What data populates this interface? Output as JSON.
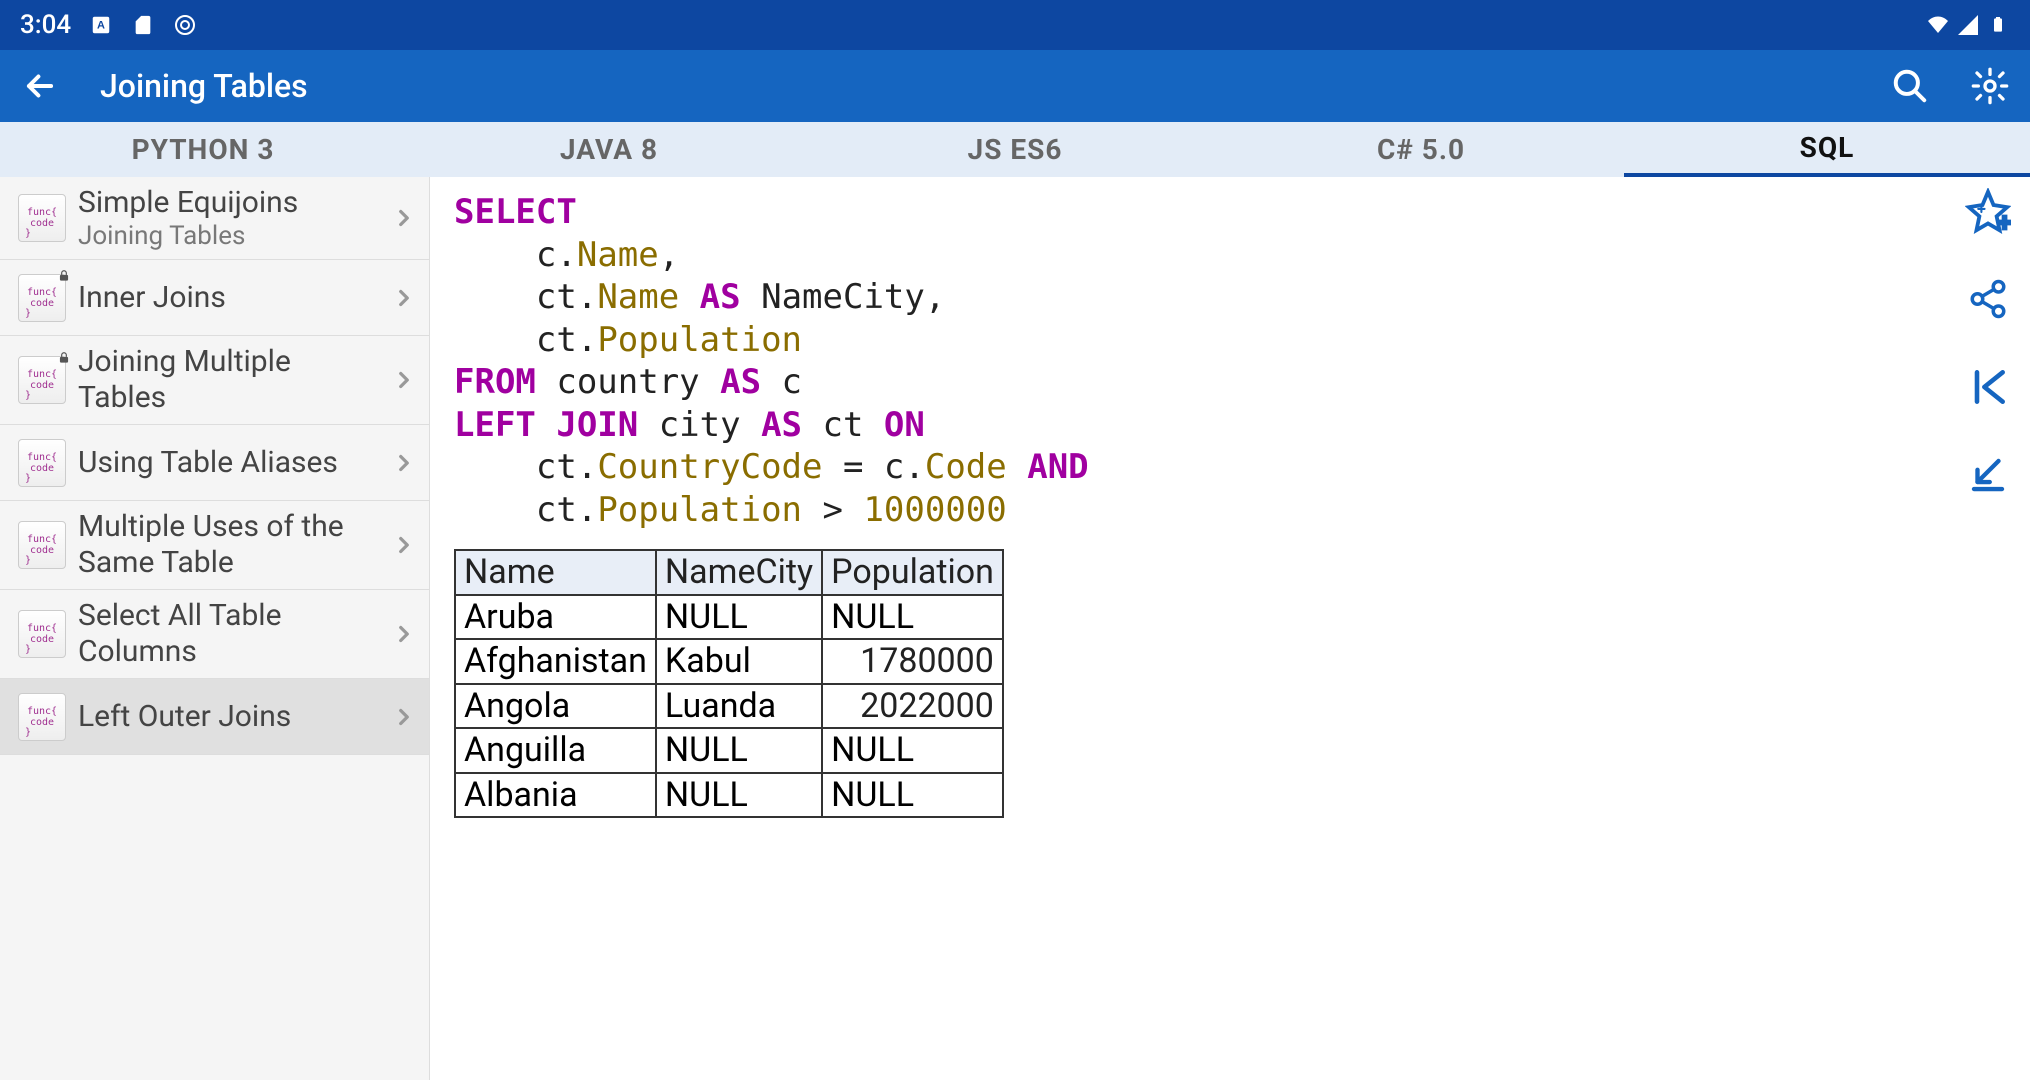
{
  "status": {
    "time": "3:04"
  },
  "appbar": {
    "title": "Joining Tables"
  },
  "tabs": [
    {
      "label": "PYTHON 3",
      "active": false
    },
    {
      "label": "JAVA 8",
      "active": false
    },
    {
      "label": "JS ES6",
      "active": false
    },
    {
      "label": "C# 5.0",
      "active": false
    },
    {
      "label": "SQL",
      "active": true
    }
  ],
  "sidebar": [
    {
      "title": "Simple Equijoins",
      "subtitle": "Joining Tables",
      "locked": false,
      "selected": false
    },
    {
      "title": "Inner Joins",
      "subtitle": "",
      "locked": true,
      "selected": false
    },
    {
      "title": "Joining Multiple Tables",
      "subtitle": "",
      "locked": true,
      "selected": false
    },
    {
      "title": "Using Table Aliases",
      "subtitle": "",
      "locked": false,
      "selected": false
    },
    {
      "title": "Multiple Uses of the Same Table",
      "subtitle": "",
      "locked": false,
      "selected": false
    },
    {
      "title": "Select All Table Columns",
      "subtitle": "",
      "locked": false,
      "selected": false
    },
    {
      "title": "Left Outer Joins",
      "subtitle": "",
      "locked": false,
      "selected": true
    }
  ],
  "code": {
    "tokens": [
      {
        "t": "SELECT",
        "c": "kw"
      },
      {
        "t": "\n    c",
        "c": ""
      },
      {
        "t": ".",
        "c": ""
      },
      {
        "t": "Name",
        "c": "id"
      },
      {
        "t": ",",
        "c": ""
      },
      {
        "t": "\n    ct",
        "c": ""
      },
      {
        "t": ".",
        "c": ""
      },
      {
        "t": "Name ",
        "c": "id"
      },
      {
        "t": "AS",
        "c": "kw"
      },
      {
        "t": " NameCity,",
        "c": ""
      },
      {
        "t": "\n    ct",
        "c": ""
      },
      {
        "t": ".",
        "c": ""
      },
      {
        "t": "Population",
        "c": "id"
      },
      {
        "t": "\n",
        "c": ""
      },
      {
        "t": "FROM",
        "c": "kw"
      },
      {
        "t": " country ",
        "c": ""
      },
      {
        "t": "AS",
        "c": "kw"
      },
      {
        "t": " c",
        "c": ""
      },
      {
        "t": "\n",
        "c": ""
      },
      {
        "t": "LEFT JOIN",
        "c": "kw"
      },
      {
        "t": " city ",
        "c": ""
      },
      {
        "t": "AS",
        "c": "kw"
      },
      {
        "t": " ct ",
        "c": ""
      },
      {
        "t": "ON",
        "c": "kw"
      },
      {
        "t": "\n    ct",
        "c": ""
      },
      {
        "t": ".",
        "c": ""
      },
      {
        "t": "CountryCode",
        "c": "id"
      },
      {
        "t": " = c",
        "c": ""
      },
      {
        "t": ".",
        "c": ""
      },
      {
        "t": "Code ",
        "c": "id"
      },
      {
        "t": "AND",
        "c": "kw"
      },
      {
        "t": "\n    ct",
        "c": ""
      },
      {
        "t": ".",
        "c": ""
      },
      {
        "t": "Population",
        "c": "id"
      },
      {
        "t": " > ",
        "c": ""
      },
      {
        "t": "1000000",
        "c": "num"
      }
    ]
  },
  "table": {
    "headers": [
      "Name",
      "NameCity",
      "Population"
    ],
    "rows": [
      [
        "Aruba",
        "NULL",
        "NULL"
      ],
      [
        "Afghanistan",
        "Kabul",
        "1780000"
      ],
      [
        "Angola",
        "Luanda",
        "2022000"
      ],
      [
        "Anguilla",
        "NULL",
        "NULL"
      ],
      [
        "Albania",
        "NULL",
        "NULL"
      ]
    ]
  },
  "actions": {
    "star": "star-add-icon",
    "share": "share-icon",
    "rewind": "go-start-icon",
    "bottom": "go-bottom-icon"
  }
}
